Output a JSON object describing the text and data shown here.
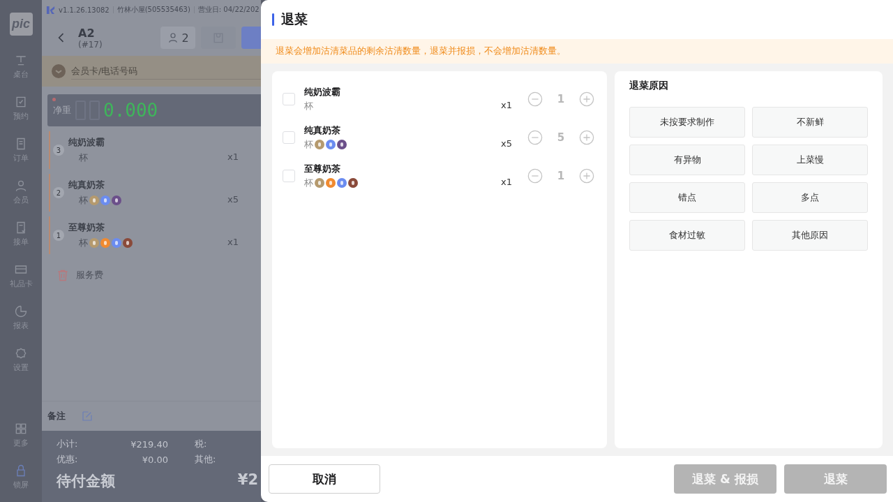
{
  "sidebar": {
    "logo": "pic",
    "items": [
      {
        "label": "桌台"
      },
      {
        "label": "预约"
      },
      {
        "label": "订单"
      },
      {
        "label": "会员"
      },
      {
        "label": "接单"
      },
      {
        "label": "礼品卡"
      },
      {
        "label": "报表"
      },
      {
        "label": "设置"
      },
      {
        "label": "更多"
      },
      {
        "label": "锁屏"
      }
    ]
  },
  "header": {
    "version": "v1.1.26.13082",
    "store": "竹林小屋(505535463)",
    "business_day": "营业日: 04/22/202"
  },
  "order": {
    "table": "A2",
    "number": "(#17)",
    "guests": "2",
    "member_placeholder": "会员卡/电话号码",
    "scale_label": "净重",
    "scale_reading": "0.000",
    "items": [
      {
        "seq": "3",
        "name": "纯奶波霸",
        "unit": "杯",
        "qty": "x1"
      },
      {
        "seq": "2",
        "name": "纯真奶茶",
        "unit": "杯",
        "tags": [
          {
            "color": "#b59a6e"
          },
          {
            "color": "#6b8cf0"
          },
          {
            "color": "#6b4f8a"
          }
        ],
        "qty": "x5"
      },
      {
        "seq": "1",
        "name": "至尊奶茶",
        "unit": "杯",
        "tags": [
          {
            "color": "#b59a6e"
          },
          {
            "color": "#f08a30"
          },
          {
            "color": "#6b8cf0"
          },
          {
            "color": "#8a4a3a"
          }
        ],
        "qty": "x1"
      }
    ],
    "service_fee": "服务费",
    "remark": "备注",
    "summary": [
      {
        "label": "小计:",
        "value": "¥219.40",
        "label2": "税:"
      },
      {
        "label": "优惠:",
        "value": "¥0.00",
        "label2": "其他:"
      }
    ],
    "due_label": "待付金额",
    "due_amount": "¥2"
  },
  "dialog": {
    "title": "退菜",
    "notice": "退菜会增加沽清菜品的剩余沽清数量，退菜并报损，不会增加沽清数量。",
    "items": [
      {
        "checked": false,
        "name": "纯奶波霸",
        "unit": "杯",
        "qty": "x1",
        "count": "1"
      },
      {
        "checked": false,
        "name": "纯真奶茶",
        "unit": "杯",
        "tags": [
          {
            "color": "#b59a6e"
          },
          {
            "color": "#6b8cf0"
          },
          {
            "color": "#6b4f8a"
          }
        ],
        "qty": "x5",
        "count": "5"
      },
      {
        "checked": false,
        "name": "至尊奶茶",
        "unit": "杯",
        "tags": [
          {
            "color": "#b59a6e"
          },
          {
            "color": "#f08a30"
          },
          {
            "color": "#6b8cf0"
          },
          {
            "color": "#8a4a3a"
          }
        ],
        "qty": "x1",
        "count": "1"
      }
    ],
    "reasons_title": "退菜原因",
    "reasons": [
      {
        "label": "未按要求制作",
        "selected": false
      },
      {
        "label": "不新鲜",
        "selected": false
      },
      {
        "label": "有异物",
        "selected": false
      },
      {
        "label": "上菜慢",
        "selected": false
      },
      {
        "label": "错点",
        "selected": false
      },
      {
        "label": "多点",
        "selected": false
      },
      {
        "label": "食材过敏",
        "selected": false
      },
      {
        "label": "其他原因",
        "selected": false
      }
    ],
    "buttons": [
      {
        "label": "取消",
        "kind": "cancel"
      },
      {
        "label": "退菜 & 报损",
        "kind": "primary",
        "disabled": true
      },
      {
        "label": "退菜",
        "kind": "primary",
        "disabled": true
      }
    ]
  }
}
